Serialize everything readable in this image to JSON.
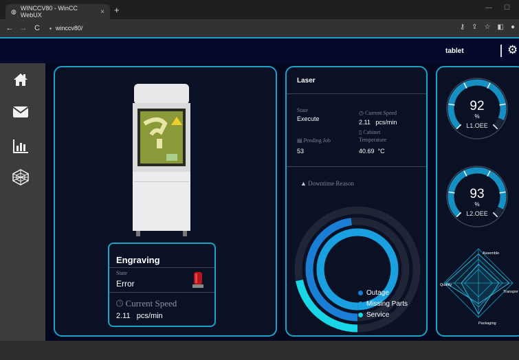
{
  "browser": {
    "tab_title": "WINCCV80 - WinCC WebUX",
    "tab_close": "×",
    "new_tab": "+",
    "url": "winccv80/",
    "win_minimize": "—",
    "win_maximize": "☐"
  },
  "header": {
    "user": "tablet"
  },
  "sidebar": {
    "items": [
      {
        "icon": "home-icon"
      },
      {
        "icon": "mail-icon"
      },
      {
        "icon": "bar-chart-icon"
      },
      {
        "icon": "network-icon"
      }
    ]
  },
  "engraving": {
    "title": "Engraving",
    "state_label": "State",
    "state_value": "Error",
    "speed_label": "Current Speed",
    "speed_value": "2.11",
    "speed_unit": "pcs/min"
  },
  "laser": {
    "title": "Laser",
    "state_label": "State",
    "state_value": "Execute",
    "speed_label": "Current Speed",
    "speed_value": "2.11",
    "speed_unit": "pcs/min",
    "pending_label": "Pending Job",
    "pending_value": "53",
    "cabinet_label_1": "Cabinet",
    "cabinet_label_2": "Temperature",
    "cabinet_value": "40.69",
    "cabinet_unit": "°C",
    "downtime_title": "Downtime Reason",
    "downtime": [
      {
        "name": "Outage",
        "color": "#1a7fd4",
        "value": 0.48
      },
      {
        "name": "Missing Parts",
        "color": "#1a9fe0",
        "value": 1.0
      },
      {
        "name": "Service",
        "color": "#18d6e6",
        "value": 0.22
      }
    ]
  },
  "oee": [
    {
      "value": "92",
      "unit": "%",
      "label": "L1.OEE",
      "level": 0.92
    },
    {
      "value": "93",
      "unit": "%",
      "label": "L2.OEE",
      "level": 0.93
    }
  ],
  "radar": {
    "labels": [
      "Assemble",
      "Transport",
      "Packaging",
      "Quality"
    ]
  },
  "colors": {
    "accent": "#1aa3c8",
    "topbar": "#050a2c",
    "panel_bg": "#0a1124"
  }
}
